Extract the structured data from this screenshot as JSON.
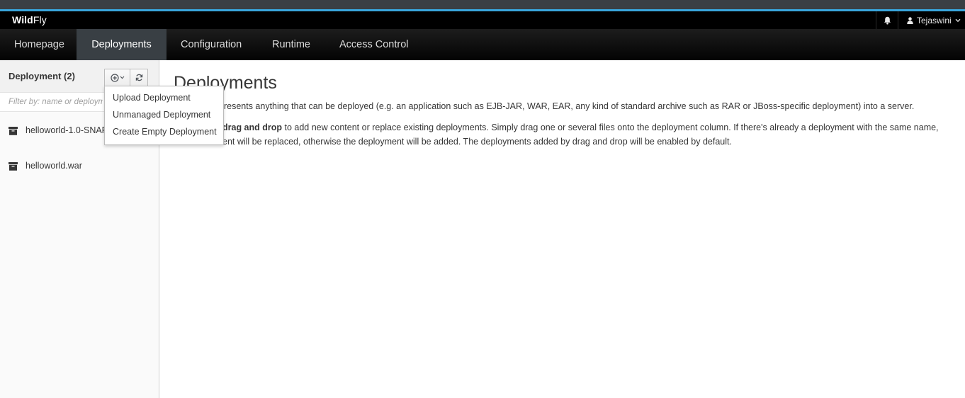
{
  "brand": {
    "bold": "Wild",
    "light": "Fly"
  },
  "header": {
    "user_name": "Tejaswini"
  },
  "nav": {
    "items": [
      {
        "label": "Homepage"
      },
      {
        "label": "Deployments"
      },
      {
        "label": "Configuration"
      },
      {
        "label": "Runtime"
      },
      {
        "label": "Access Control"
      }
    ],
    "active": "Deployments"
  },
  "column": {
    "title": "Deployment (2)",
    "filter_placeholder": "Filter by: name or deployment",
    "items": [
      {
        "label": "helloworld-1.0-SNAPSHOT.war"
      },
      {
        "label": "helloworld.war"
      }
    ]
  },
  "add_menu": {
    "items": [
      {
        "label": "Upload Deployment"
      },
      {
        "label": "Unmanaged Deployment"
      },
      {
        "label": "Create Empty Deployment"
      }
    ]
  },
  "content": {
    "title": "Deployments",
    "para1": "nt represents anything that can be deployed (e.g. an application such as EJB-JAR, WAR, EAR, any kind of standard archive such as RAR or JBoss-specific deployment) into a server.",
    "para2_bold": "drag and drop",
    "para2_rest": " to add new content or replace existing deployments. Simply drag one or several files onto the deployment column. If there's already a deployment with the same name,",
    "para3": "ent will be replaced, otherwise the deployment will be added. The deployments added by drag and drop will be enabled by default."
  },
  "colors": {
    "accent": "#39a5dc",
    "nav_active": "#393f44",
    "text": "#363636"
  },
  "icons": [
    "bell-icon",
    "user-icon",
    "chevron-down-icon",
    "plus-circle-icon",
    "refresh-icon",
    "archive-icon"
  ]
}
